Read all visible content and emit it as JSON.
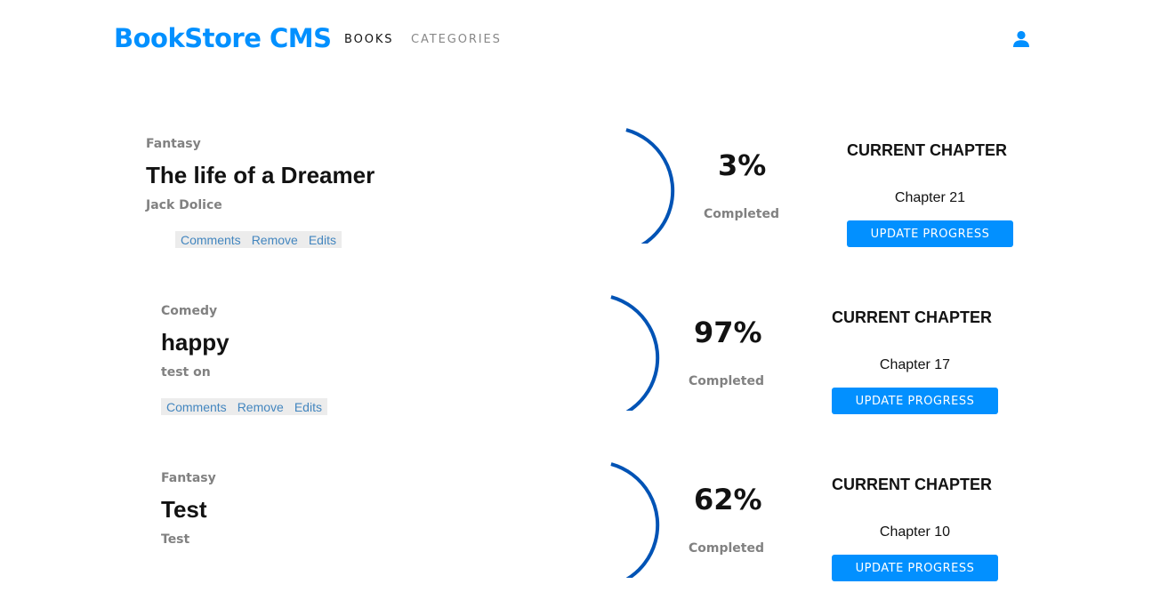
{
  "header": {
    "logo": "BookStore CMS",
    "nav": {
      "books": "BOOKS",
      "categories": "CATEGORIES"
    },
    "user_icon": "user-icon",
    "brand_color": "#0290ff"
  },
  "books": [
    {
      "genre": "Fantasy",
      "title": "The life of a Dreamer",
      "author": "Jack Dolice",
      "actions": [
        "Comments",
        "Remove",
        "Edits"
      ],
      "progress": 3,
      "percent_label": "3%",
      "completed_label": "Completed",
      "current_chapter_label": "CURRENT CHAPTER",
      "chapter": "Chapter 21",
      "update_label": "UPDATE PROGRESS"
    },
    {
      "genre": "Comedy",
      "title": "happy",
      "author": "test on",
      "actions": [
        "Comments",
        "Remove",
        "Edits"
      ],
      "progress": 97,
      "percent_label": "97%",
      "completed_label": "Completed",
      "current_chapter_label": "CURRENT CHAPTER",
      "chapter": "Chapter 17",
      "update_label": "UPDATE PROGRESS"
    },
    {
      "genre": "Fantasy",
      "title": "Test",
      "author": "Test",
      "progress": 62,
      "percent_label": "62%",
      "completed_label": "Completed",
      "current_chapter_label": "CURRENT CHAPTER",
      "chapter": "Chapter 10",
      "update_label": "UPDATE PROGRESS"
    }
  ],
  "colors": {
    "accent": "#0290ff",
    "ring": "#0053b5",
    "action_link": "#4386bf",
    "muted": "#818181"
  }
}
